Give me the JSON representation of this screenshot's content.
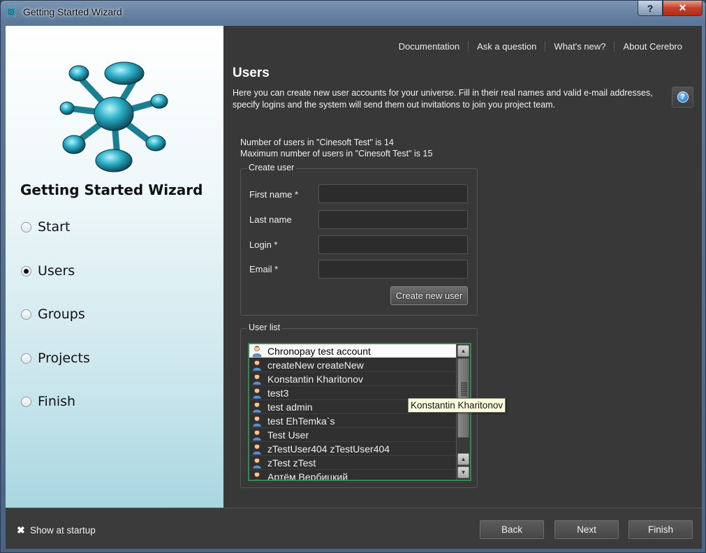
{
  "window": {
    "title": "Getting Started Wizard",
    "help_label": "?",
    "close_label": "✕"
  },
  "sidebar": {
    "title": "Getting Started Wizard",
    "steps": [
      {
        "label": "Start",
        "checked": false
      },
      {
        "label": "Users",
        "checked": true
      },
      {
        "label": "Groups",
        "checked": false
      },
      {
        "label": "Projects",
        "checked": false
      },
      {
        "label": "Finish",
        "checked": false
      }
    ]
  },
  "links": [
    "Documentation",
    "Ask a question",
    "What's new?",
    "About Cerebro"
  ],
  "page": {
    "title": "Users",
    "description": "Here you can create new user accounts for your universe. Fill in their real names and valid e-mail addresses, specify logins  and the system will send them out invitations to join you project team.",
    "info_icon": "?",
    "count_line": "Number of users in \"Cinesoft Test\" is 14",
    "max_line": "Maximum number of users in \"Cinesoft Test\" is 15"
  },
  "create_user": {
    "legend": "Create user",
    "first_name_label": "First name *",
    "last_name_label": "Last name",
    "login_label": "Login *",
    "email_label": "Email *",
    "first_name_value": "",
    "last_name_value": "",
    "login_value": "",
    "email_value": "",
    "button_label": "Create new user"
  },
  "user_list": {
    "legend": "User list",
    "users": [
      "Chronopay test account",
      "createNew createNew",
      "Konstantin Kharitonov",
      "test3",
      "test admin",
      "test EhTemka`s",
      "Test User",
      "zTestUser404 zTestUser404",
      "zTest zTest",
      "Артём Вербицкий"
    ],
    "selected_index": 0,
    "tooltip": "Konstantin Kharitonov",
    "scroll_up": "▲",
    "scroll_down": "▼"
  },
  "footer": {
    "show_at_startup_label": "Show at startup",
    "show_at_startup_checked": true,
    "back_label": "Back",
    "next_label": "Next",
    "finish_label": "Finish"
  }
}
